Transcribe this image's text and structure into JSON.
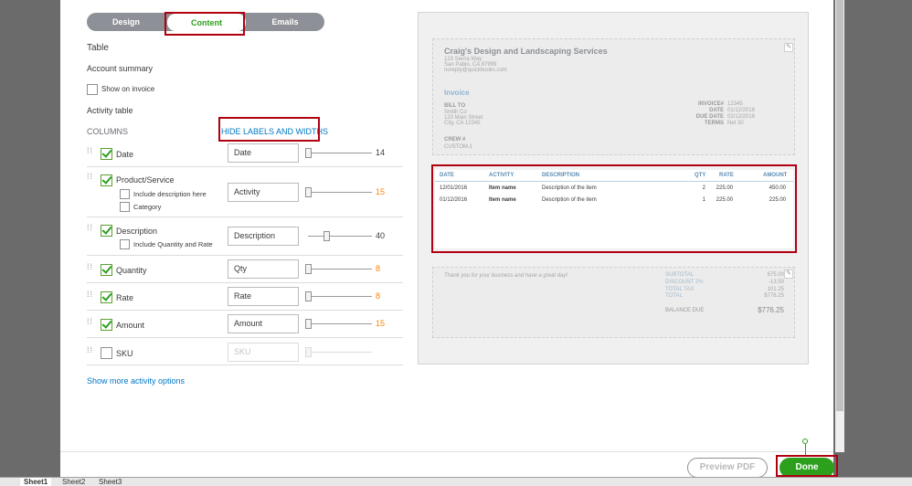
{
  "tabs": [
    {
      "label": "Design"
    },
    {
      "label": "Content"
    },
    {
      "label": "Emails"
    }
  ],
  "left": {
    "table_heading": "Table",
    "account_summary": "Account summary",
    "show_on_invoice": "Show on invoice",
    "activity_table": "Activity table",
    "columns_label": "COLUMNS",
    "hide_labels_link": "HIDE LABELS AND WIDTHS",
    "show_more_link": "Show more activity options",
    "rows": [
      {
        "name": "Date",
        "value": "Date",
        "width": "14",
        "checked": true
      },
      {
        "name": "Product/Service",
        "value": "Activity",
        "width": "15",
        "checked": true,
        "sub": [
          "Include description here",
          "Category"
        ]
      },
      {
        "name": "Description",
        "value": "Description",
        "width": "40",
        "checked": true,
        "sub": [
          "Include Quantity and Rate"
        ]
      },
      {
        "name": "Quantity",
        "value": "Qty",
        "width": "8",
        "checked": true
      },
      {
        "name": "Rate",
        "value": "Rate",
        "width": "8",
        "checked": true
      },
      {
        "name": "Amount",
        "value": "Amount",
        "width": "15",
        "checked": true
      },
      {
        "name": "SKU",
        "value": "SKU",
        "width": "",
        "checked": false
      }
    ],
    "colors": {
      "orange": "#ff8000",
      "green": "#2ca01c",
      "link": "#0077c5"
    }
  },
  "invoice": {
    "company": "Craig's Design and Landscaping Services",
    "addr1": "123 Sierra Way",
    "addr2": "San Pablo, CA 87999",
    "email": "noreply@quickbooks.com",
    "title": "Invoice",
    "bill_to_label": "BILL TO",
    "bill_to_1": "Smith Co",
    "bill_to_2": "123 Main Street",
    "bill_to_3": "City, CA 12345",
    "invoice_no_label": "INVOICE#",
    "invoice_no": "12345",
    "date_label": "DATE",
    "date": "01/12/2016",
    "due_label": "DUE DATE",
    "due": "02/12/2016",
    "terms_label": "TERMS",
    "terms": "Net 30",
    "crew_label": "CREW #",
    "crew": "CUSTOM-1",
    "headers": [
      "DATE",
      "ACTIVITY",
      "DESCRIPTION",
      "QTY",
      "RATE",
      "AMOUNT"
    ],
    "items": [
      [
        "12/01/2016",
        "Item name",
        "Description of the item",
        "2",
        "225.00",
        "450.00"
      ],
      [
        "01/12/2016",
        "Item name",
        "Description of the item",
        "1",
        "225.00",
        "225.00"
      ]
    ],
    "thanks": "Thank you for your business and have a great day!",
    "subtotal_label": "SUBTOTAL",
    "subtotal": "675.00",
    "discount_label": "DISCOUNT 2%",
    "discount": "-13.50",
    "tax_label": "TOTAL TAX",
    "tax": "101.25",
    "total_label": "TOTAL",
    "total": "$776.25",
    "balance_label": "BALANCE DUE",
    "balance": "$776.25"
  },
  "buttons": {
    "preview_pdf": "Preview PDF",
    "done": "Done"
  },
  "sheets": [
    "Sheet1",
    "Sheet2",
    "Sheet3"
  ]
}
